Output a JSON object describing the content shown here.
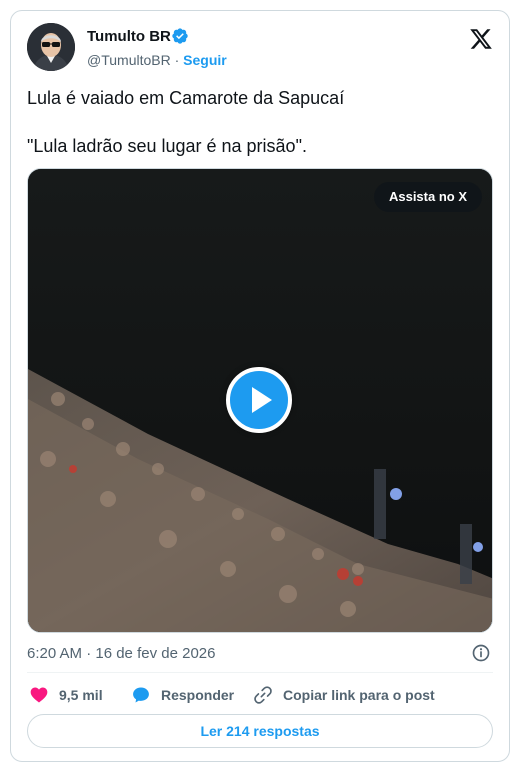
{
  "author": {
    "name": "Tumulto BR",
    "handle": "@TumultoBR",
    "separator": "·",
    "follow_label": "Seguir"
  },
  "post": {
    "lines": [
      "Lula é vaiado em Camarote da Sapucaí",
      "\"Lula ladrão seu lugar é na prisão\"."
    ],
    "media": {
      "watch_label": "Assista no X"
    },
    "timestamp": "6:20 AM · 16 de fev de 2026"
  },
  "actions": {
    "likes": "9,5 mil",
    "reply_label": "Responder",
    "copy_link_label": "Copiar link para o post"
  },
  "read_replies_label": "Ler 214 respostas",
  "colors": {
    "accent": "#1d9bf0",
    "like": "#f91880",
    "secondary_text": "#536471",
    "border": "#cfd9de"
  }
}
